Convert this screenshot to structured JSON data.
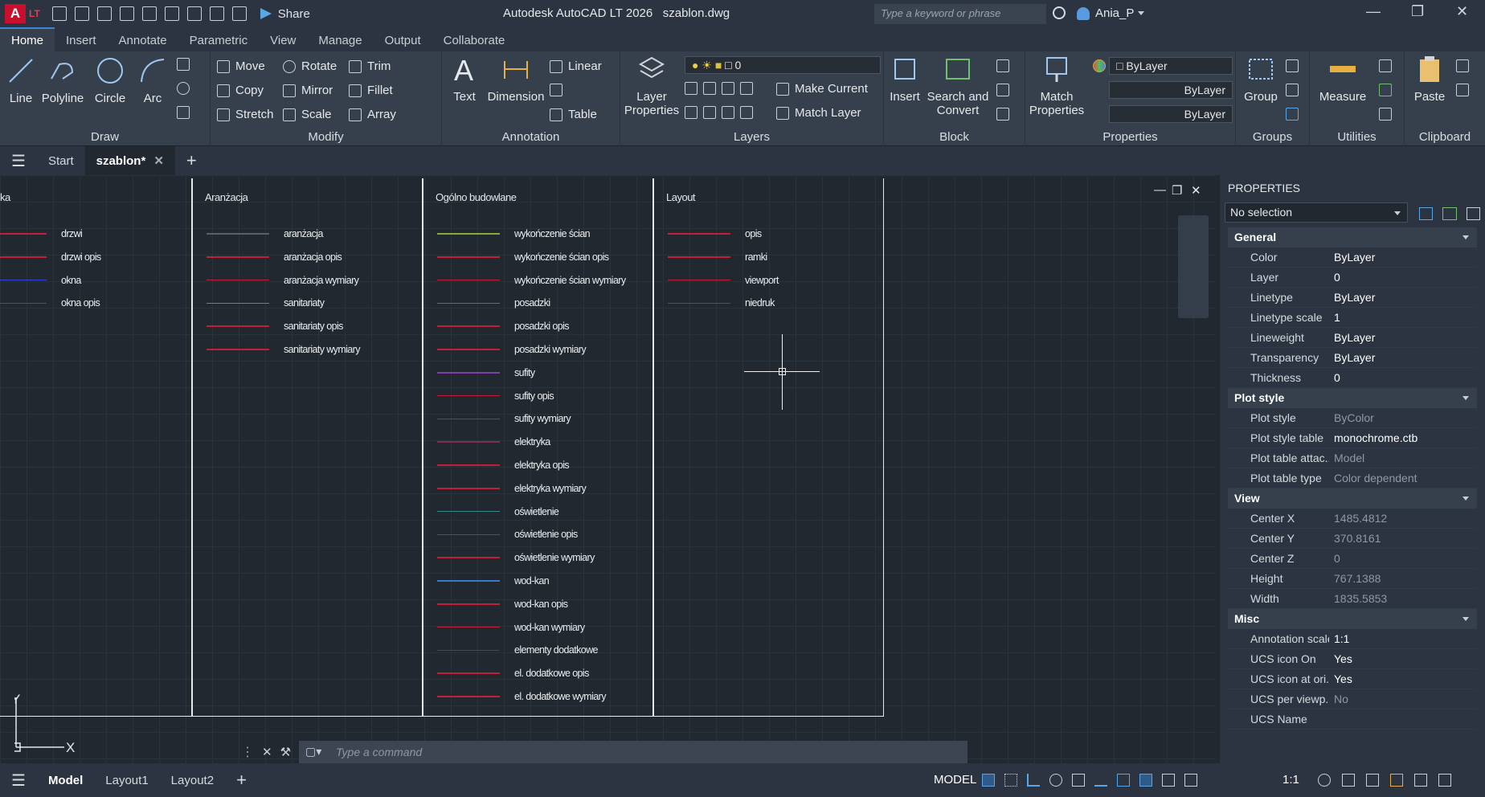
{
  "titlebar": {
    "logo_text": "A",
    "lt_text": "LT",
    "share_label": "Share",
    "app_title": "Autodesk AutoCAD LT 2026",
    "file_name": "szablon.dwg",
    "search_placeholder": "Type a keyword or phrase",
    "user_name": "Ania_P"
  },
  "ribbon_tabs": [
    "Home",
    "Insert",
    "Annotate",
    "Parametric",
    "View",
    "Manage",
    "Output",
    "Collaborate"
  ],
  "ribbon": {
    "draw": {
      "title": "Draw",
      "line": "Line",
      "polyline": "Polyline",
      "circle": "Circle",
      "arc": "Arc"
    },
    "modify": {
      "title": "Modify",
      "move": "Move",
      "rotate": "Rotate",
      "trim": "Trim",
      "copy": "Copy",
      "mirror": "Mirror",
      "fillet": "Fillet",
      "stretch": "Stretch",
      "scale": "Scale",
      "array": "Array"
    },
    "annotation": {
      "title": "Annotation",
      "text": "Text",
      "dimension": "Dimension",
      "linear": "Linear",
      "table": "Table"
    },
    "layers": {
      "title": "Layers",
      "layer_properties_1": "Layer",
      "layer_properties_2": "Properties",
      "current_layer": "0",
      "make_current": "Make Current",
      "match_layer": "Match Layer"
    },
    "block": {
      "title": "Block",
      "insert": "Insert",
      "search_convert_1": "Search and",
      "search_convert_2": "Convert"
    },
    "properties": {
      "title": "Properties",
      "match_1": "Match",
      "match_2": "Properties",
      "color": "ByLayer",
      "linetype": "ByLayer",
      "lineweight": "ByLayer"
    },
    "groups": {
      "title": "Groups",
      "group": "Group"
    },
    "utilities": {
      "title": "Utilities",
      "measure": "Measure"
    },
    "clipboard": {
      "title": "Clipboard",
      "paste": "Paste"
    }
  },
  "doc_tabs": {
    "start": "Start",
    "active": "szablon*"
  },
  "drawing": {
    "columns": [
      {
        "header": "ka",
        "rows": [
          {
            "name": "drzwi",
            "color": "#c41e3a"
          },
          {
            "name": "drzwi opis",
            "color": "#c41e3a"
          },
          {
            "name": "okna",
            "color": "#3048d8"
          },
          {
            "name": "okna opis",
            "color": "#c41e3a"
          }
        ]
      },
      {
        "header": "Aranżacja",
        "rows": [
          {
            "name": "aranżacja",
            "color": "#5a6068"
          },
          {
            "name": "aranżacja opis",
            "color": "#c41e3a"
          },
          {
            "name": "aranżacja wymiary",
            "color": "#c41e3a"
          },
          {
            "name": "sanitariaty",
            "color": "#3a8ad8"
          },
          {
            "name": "sanitariaty opis",
            "color": "#c41e3a"
          },
          {
            "name": "sanitariaty wymiary",
            "color": "#c41e3a"
          }
        ]
      },
      {
        "header": "Ogólno budowlane",
        "rows": [
          {
            "name": "wykończenie ścian",
            "color": "#8aa840"
          },
          {
            "name": "wykończenie ścian opis",
            "color": "#c41e3a"
          },
          {
            "name": "wykończenie ścian wymiary",
            "color": "#c41e3a"
          },
          {
            "name": "posadzki",
            "color": "#5a7a48"
          },
          {
            "name": "posadzki opis",
            "color": "#c41e3a"
          },
          {
            "name": "posadzki wymiary",
            "color": "#c41e3a"
          },
          {
            "name": "sufity",
            "color": "#8040a8"
          },
          {
            "name": "sufity opis",
            "color": "#c41e3a"
          },
          {
            "name": "sufity wymiary",
            "color": "#c41e3a"
          },
          {
            "name": "elektryka",
            "color": "#7a3050"
          },
          {
            "name": "elektryka opis",
            "color": "#c41e3a"
          },
          {
            "name": "elektryka wymiary",
            "color": "#c41e3a"
          },
          {
            "name": "oświetlenie",
            "color": "#3a8a8a"
          },
          {
            "name": "oświetlenie opis",
            "color": "#c41e3a"
          },
          {
            "name": "oświetlenie wymiary",
            "color": "#c41e3a"
          },
          {
            "name": "wod-kan",
            "color": "#3a78c8"
          },
          {
            "name": "wod-kan opis",
            "color": "#c41e3a"
          },
          {
            "name": "wod-kan wymiary",
            "color": "#c41e3a"
          },
          {
            "name": "elementy dodatkowe",
            "color": "#5a3a6a"
          },
          {
            "name": "el. dodatkowe opis",
            "color": "#c41e3a"
          },
          {
            "name": "el. dodatkowe wymiary",
            "color": "#c41e3a"
          }
        ]
      },
      {
        "header": "Layout",
        "rows": [
          {
            "name": "opis",
            "color": "#c41e3a"
          },
          {
            "name": "ramki",
            "color": "#c41e3a"
          },
          {
            "name": "viewport",
            "color": "#c41e3a"
          },
          {
            "name": "niedruk",
            "color": "#c41e3a"
          }
        ]
      }
    ],
    "ucs_y": "Y",
    "ucs_x": "X"
  },
  "command_line": {
    "placeholder": "Type a command"
  },
  "properties_panel": {
    "title": "PROPERTIES",
    "selection": "No selection",
    "sections": [
      {
        "name": "General",
        "rows": [
          {
            "k": "Color",
            "v": "ByLayer",
            "dim": false
          },
          {
            "k": "Layer",
            "v": "0",
            "dim": false
          },
          {
            "k": "Linetype",
            "v": "ByLayer",
            "dim": false
          },
          {
            "k": "Linetype scale",
            "v": "1",
            "dim": false
          },
          {
            "k": "Lineweight",
            "v": "ByLayer",
            "dim": false
          },
          {
            "k": "Transparency",
            "v": "ByLayer",
            "dim": false
          },
          {
            "k": "Thickness",
            "v": "0",
            "dim": false
          }
        ]
      },
      {
        "name": "Plot style",
        "rows": [
          {
            "k": "Plot style",
            "v": "ByColor",
            "dim": true
          },
          {
            "k": "Plot style table",
            "v": "monochrome.ctb",
            "dim": false
          },
          {
            "k": "Plot table attac...",
            "v": "Model",
            "dim": true
          },
          {
            "k": "Plot table type",
            "v": "Color dependent",
            "dim": true
          }
        ]
      },
      {
        "name": "View",
        "rows": [
          {
            "k": "Center X",
            "v": "1485.4812",
            "dim": true
          },
          {
            "k": "Center Y",
            "v": "370.8161",
            "dim": true
          },
          {
            "k": "Center Z",
            "v": "0",
            "dim": true
          },
          {
            "k": "Height",
            "v": "767.1388",
            "dim": true
          },
          {
            "k": "Width",
            "v": "1835.5853",
            "dim": true
          }
        ]
      },
      {
        "name": "Misc",
        "rows": [
          {
            "k": "Annotation scale",
            "v": "1:1",
            "dim": false
          },
          {
            "k": "UCS icon On",
            "v": "Yes",
            "dim": false
          },
          {
            "k": "UCS icon at ori...",
            "v": "Yes",
            "dim": false
          },
          {
            "k": "UCS per viewp...",
            "v": "No",
            "dim": true
          },
          {
            "k": "UCS Name",
            "v": "",
            "dim": false
          }
        ]
      }
    ]
  },
  "status": {
    "model_tab": "Model",
    "layout1": "Layout1",
    "layout2": "Layout2",
    "model_mode": "MODEL",
    "scale": "1:1"
  }
}
